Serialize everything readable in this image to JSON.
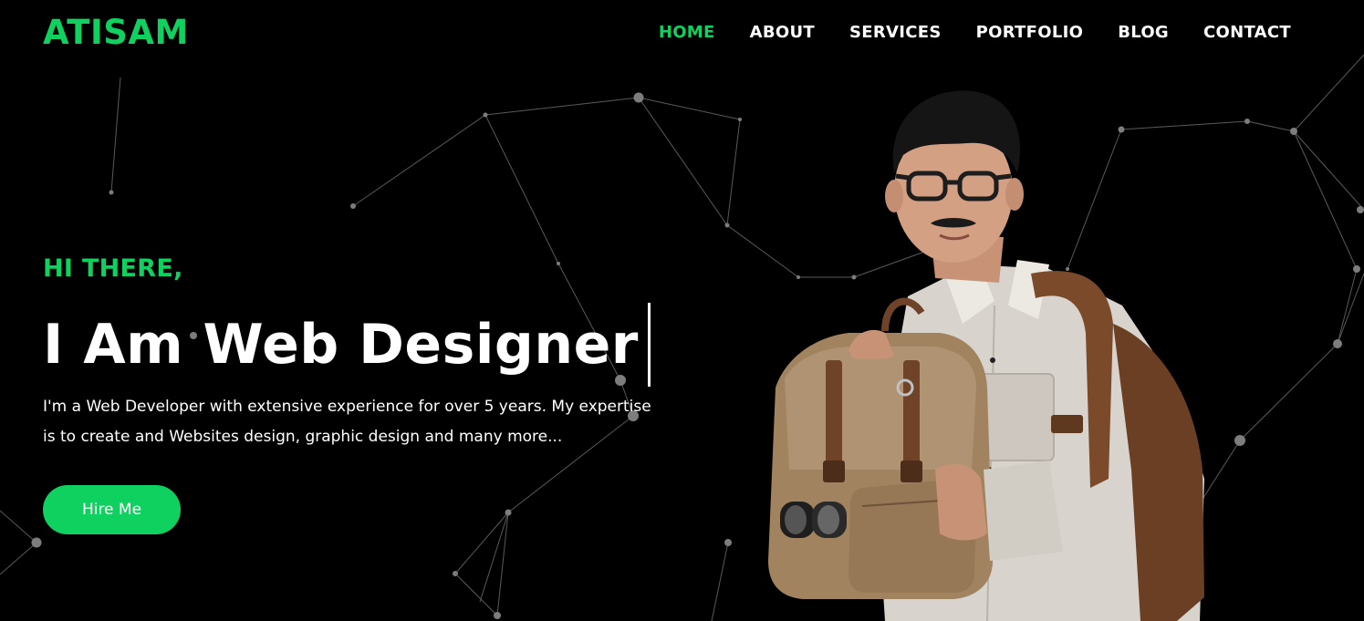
{
  "brand": {
    "logo": "ATISAM",
    "accent": "#0fd15f"
  },
  "nav": {
    "items": [
      {
        "label": "HOME",
        "active": true
      },
      {
        "label": "ABOUT",
        "active": false
      },
      {
        "label": "SERVICES",
        "active": false
      },
      {
        "label": "PORTFOLIO",
        "active": false
      },
      {
        "label": "BLOG",
        "active": false
      },
      {
        "label": "CONTACT",
        "active": false
      }
    ]
  },
  "hero": {
    "greeting": "HI THERE,",
    "headline": "I Am Web Designer",
    "description": "I'm a Web Developer with extensive experience for over 5 years. My expertise is to create and Websites design, graphic design and many more...",
    "cta_label": "Hire Me"
  },
  "colors": {
    "background": "#000000",
    "text": "#ffffff",
    "accent": "#0fd15f",
    "network": "#8a8a8a"
  },
  "icons": {
    "background": "particle-network",
    "portrait": "person-with-backpack-illustration"
  }
}
